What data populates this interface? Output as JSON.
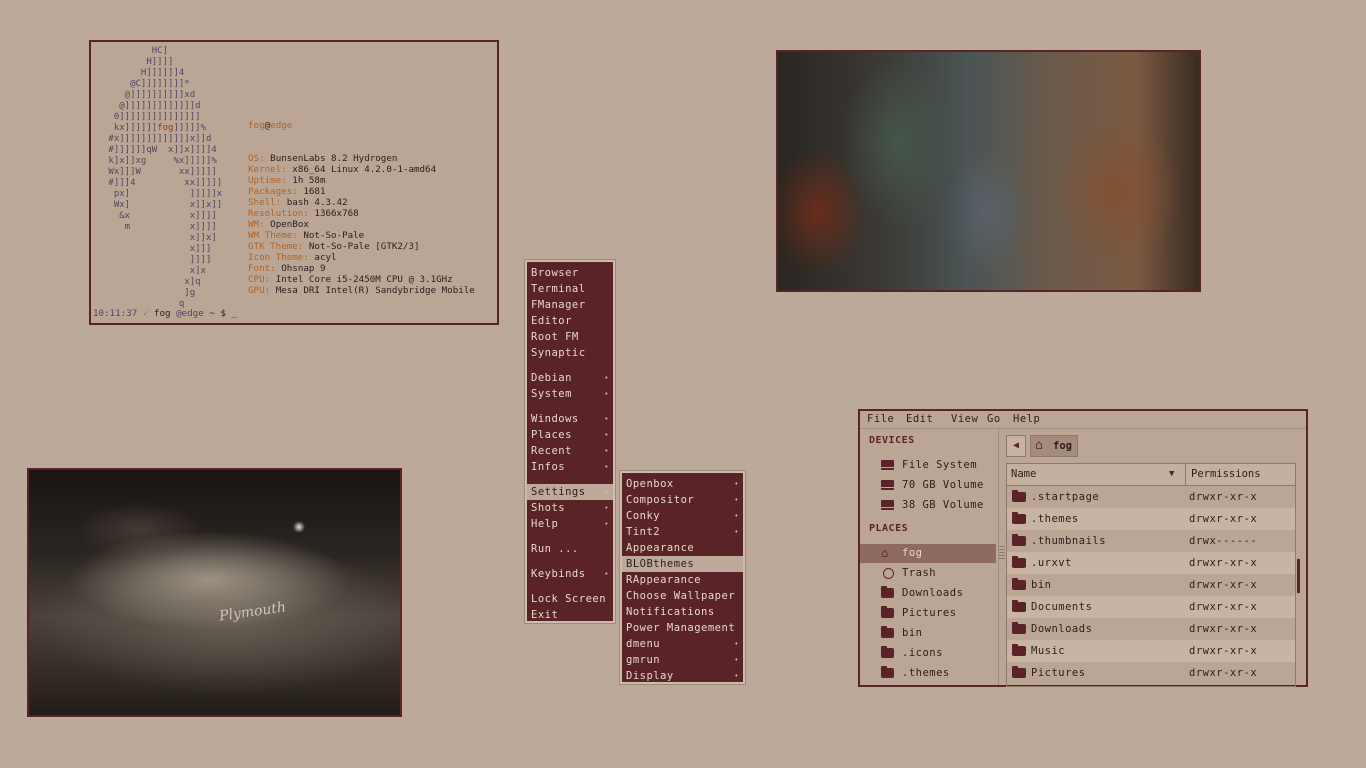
{
  "terminal": {
    "ascii_art": [
      "         HC]",
      "        H]]]]",
      "       H]]]]]]4",
      "     @C]]]]]]]]*",
      "    @]]]]]]]]]]xd",
      "   @]]]]]]]]]]]]]d",
      "  0]]]]]]]]]]]]]]]",
      "  kx]]]]]]fog]]]]]%",
      " #x]]]]]]]]]]]]]x]]d",
      " #]]]]]]qW  x]]x]]]]4",
      " k]x]]xg     %x]]]]]%",
      " Wx]]]W       xx]]]]]",
      " #]]]4         xx]]]]]",
      "  px]           ]]]]]x",
      "  Wx]           x]]x]]",
      "   &x           x]]]]",
      "    m           x]]]]",
      "                x]]x]",
      "                x]]]",
      "                ]]]]",
      "                x]x",
      "               x]q",
      "               ]g",
      "              q"
    ],
    "user": "fog",
    "at": "@",
    "host": "edge",
    "info": [
      {
        "key": "OS:",
        "value": "BunsenLabs 8.2 Hydrogen"
      },
      {
        "key": "Kernel:",
        "value": "x86_64 Linux 4.2.0-1-amd64"
      },
      {
        "key": "Uptime:",
        "value": "1h 58m"
      },
      {
        "key": "Packages:",
        "value": "1681"
      },
      {
        "key": "Shell:",
        "value": "bash 4.3.42"
      },
      {
        "key": "Resolution:",
        "value": "1366x768"
      },
      {
        "key": "WM:",
        "value": "OpenBox"
      },
      {
        "key": "WM Theme:",
        "value": "Not-So-Pale"
      },
      {
        "key": "GTK Theme:",
        "value": "Not-So-Pale [GTK2/3]"
      },
      {
        "key": "Icon Theme:",
        "value": "acyl"
      },
      {
        "key": "Font:",
        "value": "Ohsnap 9"
      },
      {
        "key": "CPU:",
        "value": "Intel Core i5-2450M CPU @ 3.1GHz"
      },
      {
        "key": "GPU:",
        "value": "Mesa DRI Intel(R) Sandybridge Mobile"
      }
    ],
    "prompt": {
      "time": "10:11:37",
      "check": "✓",
      "user": "fog",
      "host": "@edge",
      "rest": " ~ $ _"
    }
  },
  "wallpaper2_script": "Plymouth",
  "root_menu": {
    "items": [
      {
        "label": "Browser",
        "submenu": false,
        "group": 0
      },
      {
        "label": "Terminal",
        "submenu": false,
        "group": 0
      },
      {
        "label": "FManager",
        "submenu": false,
        "group": 0
      },
      {
        "label": "Editor",
        "submenu": false,
        "group": 0
      },
      {
        "label": "Root FM",
        "submenu": false,
        "group": 0
      },
      {
        "label": "Synaptic",
        "submenu": false,
        "group": 0
      },
      {
        "label": "Debian",
        "submenu": true,
        "group": 1
      },
      {
        "label": "System",
        "submenu": true,
        "group": 1
      },
      {
        "label": "Windows",
        "submenu": true,
        "group": 2
      },
      {
        "label": "Places",
        "submenu": true,
        "group": 2
      },
      {
        "label": "Recent",
        "submenu": true,
        "group": 2
      },
      {
        "label": "Infos",
        "submenu": true,
        "group": 2
      },
      {
        "label": "Settings",
        "submenu": true,
        "group": 3,
        "selected": true
      },
      {
        "label": "Shots",
        "submenu": true,
        "group": 3
      },
      {
        "label": "Help",
        "submenu": true,
        "group": 3
      },
      {
        "label": "Run ...",
        "submenu": false,
        "group": 4
      },
      {
        "label": "Keybinds",
        "submenu": true,
        "group": 5
      },
      {
        "label": "Lock Screen",
        "submenu": false,
        "group": 6
      },
      {
        "label": "Exit",
        "submenu": false,
        "group": 6
      }
    ],
    "arrow": "•"
  },
  "settings_menu": {
    "items": [
      {
        "label": "Openbox",
        "submenu": true
      },
      {
        "label": "Compositor",
        "submenu": true
      },
      {
        "label": "Conky",
        "submenu": true
      },
      {
        "label": "Tint2",
        "submenu": true
      },
      {
        "label": "Appearance",
        "submenu": false
      },
      {
        "label": "BLOBthemes",
        "submenu": false,
        "selected": true
      },
      {
        "label": "RAppearance",
        "submenu": false
      },
      {
        "label": "Choose Wallpaper",
        "submenu": false
      },
      {
        "label": "Notifications",
        "submenu": false
      },
      {
        "label": "Power Management",
        "submenu": false
      },
      {
        "label": "dmenu",
        "submenu": true
      },
      {
        "label": "gmrun",
        "submenu": true
      },
      {
        "label": "Display",
        "submenu": true
      }
    ]
  },
  "file_manager": {
    "menubar": [
      "File",
      "Edit",
      "View",
      "Go",
      "Help"
    ],
    "devices_header": "DEVICES",
    "devices": [
      "File System",
      "70 GB Volume",
      "38 GB Volume"
    ],
    "places_header": "PLACES",
    "places": [
      {
        "label": "fog",
        "icon": "home-icon",
        "selected": true
      },
      {
        "label": "Trash",
        "icon": "trash-icon"
      },
      {
        "label": "Downloads",
        "icon": "downloads-folder-icon"
      },
      {
        "label": "Pictures",
        "icon": "pictures-folder-icon"
      },
      {
        "label": "bin",
        "icon": "folder-icon"
      },
      {
        "label": ".icons",
        "icon": "folder-icon"
      },
      {
        "label": ".themes",
        "icon": "folder-icon"
      }
    ],
    "back_label": "◀",
    "path_crumb": "fog",
    "columns": {
      "name": "Name",
      "permissions": "Permissions",
      "sort_indicator": "▼"
    },
    "rows": [
      {
        "name": ".startpage",
        "perm": "drwxr-xr-x"
      },
      {
        "name": ".themes",
        "perm": "drwxr-xr-x"
      },
      {
        "name": ".thumbnails",
        "perm": "drwx------"
      },
      {
        "name": ".urxvt",
        "perm": "drwxr-xr-x"
      },
      {
        "name": "bin",
        "perm": "drwxr-xr-x"
      },
      {
        "name": "Documents",
        "perm": "drwxr-xr-x"
      },
      {
        "name": "Downloads",
        "perm": "drwxr-xr-x"
      },
      {
        "name": "Music",
        "perm": "drwxr-xr-x"
      },
      {
        "name": "Pictures",
        "perm": "drwxr-xr-x"
      }
    ]
  },
  "colors": {
    "desktop": "#bda999",
    "accent": "#5a2328",
    "menu_text": "#e8d8c8",
    "terminal_key": "#b06426",
    "terminal_ascii": "#4e4664"
  }
}
